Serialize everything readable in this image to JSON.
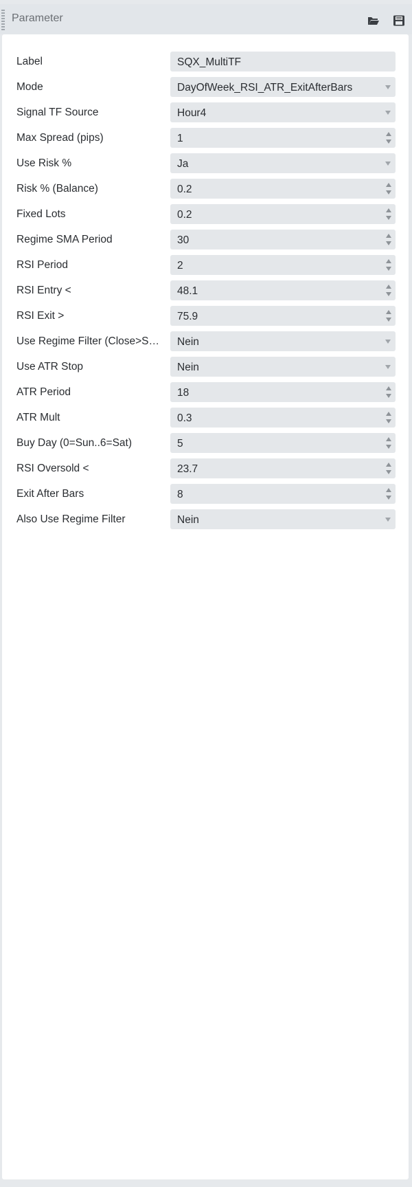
{
  "panel": {
    "title": "Parameter",
    "icons": [
      "folder-open-icon",
      "save-icon"
    ]
  },
  "params": [
    {
      "label": "Label",
      "value": "SQX_MultiTF",
      "type": "text"
    },
    {
      "label": "Mode",
      "value": "DayOfWeek_RSI_ATR_ExitAfterBars",
      "type": "select"
    },
    {
      "label": "Signal TF Source",
      "value": "Hour4",
      "type": "select"
    },
    {
      "label": "Max Spread (pips)",
      "value": "1",
      "type": "number"
    },
    {
      "label": "Use Risk %",
      "value": "Ja",
      "type": "select"
    },
    {
      "label": "Risk % (Balance)",
      "value": "0.2",
      "type": "number"
    },
    {
      "label": "Fixed Lots",
      "value": "0.2",
      "type": "number"
    },
    {
      "label": "Regime SMA Period",
      "value": "30",
      "type": "number"
    },
    {
      "label": "RSI Period",
      "value": "2",
      "type": "number"
    },
    {
      "label": "RSI Entry <",
      "value": "48.1",
      "type": "number"
    },
    {
      "label": "RSI Exit >",
      "value": "75.9",
      "type": "number"
    },
    {
      "label": "Use Regime Filter (Close>S…",
      "value": "Nein",
      "type": "select"
    },
    {
      "label": "Use ATR Stop",
      "value": "Nein",
      "type": "select"
    },
    {
      "label": "ATR Period",
      "value": "18",
      "type": "number"
    },
    {
      "label": "ATR Mult",
      "value": "0.3",
      "type": "number"
    },
    {
      "label": "Buy Day (0=Sun..6=Sat)",
      "value": "5",
      "type": "number"
    },
    {
      "label": "RSI Oversold <",
      "value": "23.7",
      "type": "number"
    },
    {
      "label": "Exit After Bars",
      "value": "8",
      "type": "number"
    },
    {
      "label": "Also Use Regime Filter",
      "value": "Nein",
      "type": "select"
    }
  ]
}
